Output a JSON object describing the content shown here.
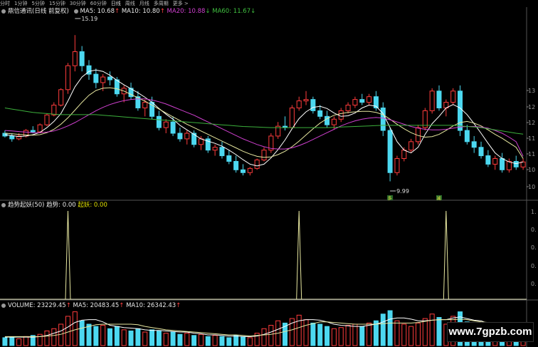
{
  "toolbar": {
    "items": [
      "分时",
      "1分钟",
      "5分钟",
      "15分钟",
      "30分钟",
      "60分钟",
      "日线",
      "周线",
      "月线",
      "多周期",
      "更多 >"
    ],
    "selected": "日线"
  },
  "main_panel": {
    "title": "鼎信通讯(日线 前复权)",
    "ma5_label": "MA5: 10.68",
    "ma10_label": "MA10: 10.80",
    "ma20_label": "MA20: 10.88",
    "ma60_label": "MA60: 11.67",
    "ma5_arrow": "↑",
    "ma10_arrow": "↑",
    "ma20_arrow": "↓",
    "ma60_arrow": "↓",
    "high_marker": "15.19",
    "low_marker": "9.99",
    "signal_marks": [
      "多",
      "减"
    ]
  },
  "indicator_panel": {
    "title": "趋势起妖(50)",
    "trend_label": "趋势: 0.00",
    "qiyao_label": "起妖: 0.00",
    "y_ticks": [
      "1.",
      "0.",
      "0.",
      "0.",
      "0."
    ]
  },
  "volume_panel": {
    "volume_label": "VOLUME: 23229.45",
    "ma5_label": "MA5: 20483.45",
    "ma10_label": "MA10: 26342.43",
    "volume_arrow": "↑",
    "ma5_arrow": "↑",
    "ma10_arrow": "↑"
  },
  "watermark": "www.7gpzb.com",
  "colors": {
    "up": "#ff3c3c",
    "down": "#4cd8f0",
    "ma5": "#ffffff",
    "ma10": "#e8e8a0",
    "ma20": "#d040d0",
    "ma60": "#3cb03c",
    "indicator": "#e8e8c0"
  },
  "chart_data": {
    "type": "candlestick",
    "y_ticks": [
      "13",
      "12",
      "12",
      "11",
      "11",
      "10",
      "10"
    ],
    "ylim": [
      9.8,
      13.6
    ],
    "peaks": [
      {
        "label": "15.19",
        "value": 15.19
      },
      {
        "label": "9.99",
        "value": 9.99
      }
    ],
    "candles": [
      [
        11.7,
        11.8,
        11.55,
        11.6
      ],
      [
        11.6,
        11.7,
        11.4,
        11.5
      ],
      [
        11.5,
        11.7,
        11.45,
        11.6
      ],
      [
        11.6,
        11.85,
        11.55,
        11.8
      ],
      [
        11.8,
        11.95,
        11.7,
        11.75
      ],
      [
        11.75,
        12.05,
        11.7,
        12.0
      ],
      [
        12.0,
        12.4,
        11.95,
        12.35
      ],
      [
        12.35,
        12.8,
        12.3,
        12.7
      ],
      [
        12.7,
        13.3,
        12.65,
        13.25
      ],
      [
        13.25,
        14.2,
        13.1,
        14.1
      ],
      [
        14.1,
        15.19,
        13.9,
        14.6
      ],
      [
        14.6,
        14.8,
        13.9,
        14.1
      ],
      [
        14.1,
        14.3,
        13.6,
        13.8
      ],
      [
        13.8,
        14.0,
        13.3,
        13.5
      ],
      [
        13.5,
        13.8,
        13.2,
        13.7
      ],
      [
        13.7,
        13.9,
        13.4,
        13.6
      ],
      [
        13.6,
        13.7,
        13.0,
        13.1
      ],
      [
        13.1,
        13.4,
        12.8,
        13.3
      ],
      [
        13.3,
        13.5,
        12.9,
        13.0
      ],
      [
        13.0,
        13.2,
        12.5,
        12.6
      ],
      [
        12.6,
        12.9,
        12.3,
        12.8
      ],
      [
        12.8,
        13.0,
        12.2,
        12.3
      ],
      [
        12.3,
        12.5,
        11.8,
        11.9
      ],
      [
        11.9,
        12.2,
        11.7,
        12.1
      ],
      [
        12.1,
        12.3,
        11.6,
        11.7
      ],
      [
        11.7,
        11.9,
        11.4,
        11.5
      ],
      [
        11.5,
        11.8,
        11.3,
        11.7
      ],
      [
        11.7,
        11.8,
        11.2,
        11.3
      ],
      [
        11.3,
        11.6,
        11.1,
        11.5
      ],
      [
        11.5,
        11.6,
        11.0,
        11.1
      ],
      [
        11.1,
        11.3,
        10.9,
        11.2
      ],
      [
        11.2,
        11.4,
        10.8,
        10.9
      ],
      [
        10.9,
        11.1,
        10.6,
        10.7
      ],
      [
        10.7,
        10.9,
        10.3,
        10.4
      ],
      [
        10.4,
        10.6,
        10.2,
        10.3
      ],
      [
        10.3,
        10.5,
        10.2,
        10.45
      ],
      [
        10.45,
        10.8,
        10.4,
        10.75
      ],
      [
        10.75,
        11.2,
        10.7,
        11.1
      ],
      [
        11.1,
        11.7,
        11.0,
        11.6
      ],
      [
        11.6,
        12.1,
        11.5,
        11.95
      ],
      [
        11.95,
        12.3,
        11.8,
        11.9
      ],
      [
        11.9,
        12.7,
        11.85,
        12.6
      ],
      [
        12.6,
        13.0,
        12.5,
        12.85
      ],
      [
        12.85,
        13.2,
        12.7,
        12.9
      ],
      [
        12.9,
        13.0,
        12.4,
        12.5
      ],
      [
        12.5,
        12.7,
        12.2,
        12.3
      ],
      [
        12.3,
        12.5,
        11.9,
        12.0
      ],
      [
        12.0,
        12.3,
        11.85,
        12.2
      ],
      [
        12.2,
        12.6,
        12.1,
        12.5
      ],
      [
        12.5,
        12.8,
        12.4,
        12.7
      ],
      [
        12.7,
        13.0,
        12.6,
        12.9
      ],
      [
        12.9,
        13.1,
        12.7,
        12.8
      ],
      [
        12.8,
        13.1,
        12.7,
        13.0
      ],
      [
        13.0,
        13.2,
        12.5,
        12.6
      ],
      [
        12.6,
        12.8,
        11.6,
        11.8
      ],
      [
        11.8,
        11.9,
        9.99,
        10.3
      ],
      [
        10.3,
        10.9,
        10.2,
        10.8
      ],
      [
        10.8,
        11.2,
        10.7,
        11.1
      ],
      [
        11.1,
        11.5,
        11.0,
        11.4
      ],
      [
        11.4,
        12.0,
        11.3,
        11.9
      ],
      [
        11.9,
        12.6,
        11.8,
        12.5
      ],
      [
        12.5,
        13.3,
        12.4,
        13.2
      ],
      [
        13.2,
        13.4,
        12.5,
        12.6
      ],
      [
        12.6,
        12.9,
        12.3,
        12.8
      ],
      [
        12.8,
        13.3,
        12.7,
        13.2
      ],
      [
        13.2,
        13.4,
        11.6,
        11.8
      ],
      [
        11.8,
        12.0,
        11.3,
        11.4
      ],
      [
        11.4,
        11.6,
        11.0,
        11.2
      ],
      [
        11.2,
        11.4,
        10.8,
        10.9
      ],
      [
        10.9,
        11.1,
        10.5,
        10.6
      ],
      [
        10.6,
        10.9,
        10.4,
        10.8
      ],
      [
        10.8,
        11.0,
        10.3,
        10.4
      ],
      [
        10.4,
        10.8,
        10.3,
        10.7
      ],
      [
        10.7,
        10.9,
        10.4,
        10.5
      ],
      [
        10.5,
        10.8,
        10.4,
        10.68
      ]
    ],
    "ma_series": [
      {
        "name": "MA5",
        "values": [
          11.65,
          11.62,
          11.58,
          11.6,
          11.65,
          11.73,
          11.9,
          12.12,
          12.4,
          12.85,
          13.35,
          13.7,
          13.9,
          13.95,
          13.9,
          13.76,
          13.58,
          13.42,
          13.28,
          13.14,
          12.98,
          12.8,
          12.58,
          12.38,
          12.2,
          11.98,
          11.82,
          11.66,
          11.5,
          11.42,
          11.34,
          11.24,
          11.1,
          10.94,
          10.76,
          10.6,
          10.54,
          10.6,
          10.82,
          11.12,
          11.46,
          11.86,
          12.22,
          12.46,
          12.62,
          12.66,
          12.58,
          12.42,
          12.3,
          12.32,
          12.42,
          12.6,
          12.7,
          12.66,
          12.4,
          11.9,
          11.4,
          11.1,
          11.0,
          11.2,
          11.66,
          12.04,
          12.3,
          12.6,
          12.72,
          12.6,
          12.36,
          12.04,
          11.7,
          11.34,
          11.0,
          10.8,
          10.68,
          10.62,
          10.68
        ]
      },
      {
        "name": "MA10",
        "values": [
          11.7,
          11.68,
          11.66,
          11.64,
          11.63,
          11.65,
          11.72,
          11.84,
          12.02,
          12.25,
          12.52,
          12.8,
          13.05,
          13.22,
          13.3,
          13.32,
          13.28,
          13.2,
          13.08,
          12.96,
          12.84,
          12.7,
          12.56,
          12.42,
          12.28,
          12.15,
          12.02,
          11.9,
          11.78,
          11.66,
          11.54,
          11.42,
          11.3,
          11.18,
          11.06,
          10.96,
          10.88,
          10.84,
          10.86,
          10.94,
          11.06,
          11.22,
          11.42,
          11.64,
          11.86,
          12.06,
          12.22,
          12.34,
          12.4,
          12.44,
          12.46,
          12.48,
          12.48,
          12.44,
          12.36,
          12.2,
          12.02,
          11.86,
          11.72,
          11.62,
          11.56,
          11.58,
          11.66,
          11.8,
          11.96,
          12.08,
          12.12,
          12.06,
          11.96,
          11.82,
          11.66,
          11.52,
          11.36,
          11.2,
          10.8
        ]
      },
      {
        "name": "MA20",
        "values": [
          11.8,
          11.78,
          11.76,
          11.74,
          11.72,
          11.72,
          11.74,
          11.78,
          11.86,
          11.96,
          12.08,
          12.22,
          12.36,
          12.5,
          12.62,
          12.72,
          12.8,
          12.86,
          12.9,
          12.92,
          12.92,
          12.88,
          12.82,
          12.74,
          12.64,
          12.54,
          12.44,
          12.34,
          12.22,
          12.1,
          11.98,
          11.86,
          11.74,
          11.62,
          11.5,
          11.4,
          11.3,
          11.22,
          11.16,
          11.14,
          11.14,
          11.18,
          11.26,
          11.36,
          11.48,
          11.6,
          11.72,
          11.84,
          11.96,
          12.06,
          12.14,
          12.2,
          12.24,
          12.26,
          12.24,
          12.18,
          12.1,
          12.02,
          11.94,
          11.88,
          11.84,
          11.82,
          11.82,
          11.84,
          11.88,
          11.92,
          11.94,
          11.94,
          11.92,
          11.88,
          11.8,
          11.7,
          11.56,
          11.4,
          10.88
        ]
      },
      {
        "name": "MA60",
        "values": [
          12.6,
          12.56,
          12.52,
          12.48,
          12.44,
          12.42,
          12.4,
          12.38,
          12.36,
          12.36,
          12.36,
          12.36,
          12.36,
          12.36,
          12.34,
          12.32,
          12.3,
          12.28,
          12.26,
          12.24,
          12.22,
          12.2,
          12.18,
          12.16,
          12.14,
          12.12,
          12.1,
          12.08,
          12.06,
          12.04,
          12.02,
          12.0,
          11.98,
          11.96,
          11.94,
          11.93,
          11.92,
          11.91,
          11.9,
          11.9,
          11.9,
          11.9,
          11.9,
          11.9,
          11.9,
          11.9,
          11.9,
          11.91,
          11.92,
          11.93,
          11.94,
          11.95,
          11.96,
          11.97,
          11.98,
          11.98,
          11.98,
          11.98,
          11.98,
          11.98,
          11.98,
          11.98,
          11.98,
          11.98,
          11.98,
          11.96,
          11.94,
          11.92,
          11.9,
          11.86,
          11.82,
          11.78,
          11.74,
          11.7,
          11.67
        ]
      }
    ],
    "indicator": {
      "name": "趋势起妖",
      "spike_indices": [
        9,
        42,
        63
      ],
      "value_range": [
        0,
        1
      ]
    },
    "volume": {
      "values": [
        14,
        15,
        12,
        16,
        18,
        20,
        26,
        30,
        38,
        52,
        60,
        44,
        38,
        34,
        36,
        30,
        34,
        28,
        26,
        30,
        24,
        28,
        26,
        22,
        24,
        20,
        22,
        18,
        20,
        16,
        18,
        16,
        14,
        18,
        16,
        14,
        22,
        30,
        36,
        44,
        40,
        48,
        54,
        46,
        40,
        38,
        34,
        30,
        32,
        36,
        38,
        34,
        40,
        44,
        56,
        62,
        44,
        38,
        34,
        40,
        48,
        56,
        50,
        38,
        52,
        60,
        42,
        34,
        30,
        28,
        26,
        24,
        22,
        24,
        23
      ],
      "ma5": [
        15,
        15,
        15,
        15,
        15,
        16,
        18,
        22,
        26,
        33,
        41,
        45,
        46,
        46,
        42,
        36,
        34,
        32,
        31,
        30,
        28,
        27,
        27,
        26,
        25,
        24,
        24,
        22,
        21,
        19,
        19,
        18,
        17,
        17,
        16,
        16,
        17,
        20,
        24,
        29,
        34,
        40,
        44,
        46,
        46,
        45,
        42,
        38,
        36,
        35,
        34,
        34,
        36,
        38,
        42,
        47,
        49,
        49,
        47,
        44,
        44,
        45,
        46,
        46,
        49,
        51,
        48,
        45,
        44,
        39,
        32,
        29,
        27,
        25,
        23
      ],
      "ma10": [
        16,
        16,
        16,
        16,
        16,
        16,
        17,
        18,
        20,
        24,
        28,
        31,
        34,
        37,
        38,
        38,
        38,
        38,
        38,
        37,
        34,
        32,
        30,
        28,
        27,
        26,
        25,
        24,
        23,
        22,
        21,
        20,
        19,
        19,
        18,
        17,
        18,
        19,
        20,
        22,
        25,
        28,
        32,
        36,
        39,
        42,
        42,
        41,
        40,
        39,
        38,
        38,
        38,
        38,
        39,
        40,
        40,
        40,
        40,
        41,
        43,
        45,
        46,
        46,
        46,
        47,
        46,
        44,
        42,
        41,
        39,
        38,
        36,
        35,
        26
      ]
    }
  }
}
